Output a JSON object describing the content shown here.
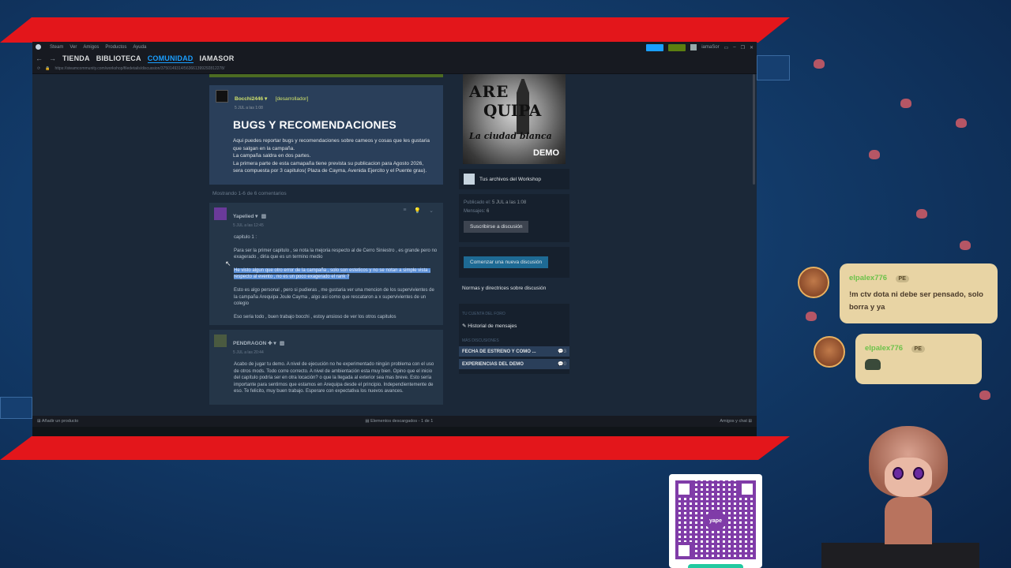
{
  "titlebar": {
    "menu": [
      "Steam",
      "Ver",
      "Amigos",
      "Productos",
      "Ayuda"
    ],
    "user": "iamaSor"
  },
  "nav": {
    "items": [
      "TIENDA",
      "BIBLIOTECA",
      "COMUNIDAD",
      "IAMASOR"
    ],
    "active": "COMUNIDAD",
    "url": "https://steamcommunity.com/workshop/filedetails/discussion/3750149314/563661399292812278/"
  },
  "op": {
    "author": "Bocchi2446",
    "role": "[desarrollador]",
    "date": "5 JUL a las 1:08",
    "title": "BUGS Y RECOMENDACIONES",
    "body": [
      "Aqui puedes reportar bugs y recomendaciones sobre cameos y cosas que les gustaria que salgan en la campaña.",
      "La campaña saldra en dos partes.",
      "La primera parte de esta camapaña tiene prevista su publicacion para Agosto 2026, sera compuesta por 3 capitulos( Plaza de Cayma, Avenida Ejercito y el Puente grau)."
    ]
  },
  "showing": "Mostrando 1-6 de 6 comentarios",
  "comments": [
    {
      "author": "Yapelied",
      "date": "5 JUL a las 12:45",
      "paragraphs": [
        "capitulo 1 :",
        "Para ser la primer capitulo , se nota la mejoria respecto al de Cerro Siniestro , es grande pero no exagerado , diria que es un termino medio",
        "He visto algun que otro error de la campaña , solo son esteticos y no se notan a simple vista , respecto al evento , no es un poco exagerado el rank ?",
        "Esto es algo personal , pero si pudieras , me gustaria ver una mencion de los supervivientes de la campaña Arequipa Joule Cayma , algo asi como que rescataron a x supervivientes de un colegio",
        "Eso seria todo , buen trabajo bocchi , estoy ansioso de ver los otros capitulos"
      ]
    },
    {
      "author": "PENDRAGON",
      "date": "5 JUL a las 20:44",
      "paragraphs": [
        "Acabo de jugar tu demo. A nivel de ejecución no he experimentado ningún problema con el uso de otros mods. Todo corre correcto. A nivel de ambientación esta muy bien. Opino que el inicio del capítulo podría ser en otra locación? o que la llegada al exterior sea mas breve. Esto sería importante para sentirnos que estamos en Arequipa desde el principio. Independientemente de eso. Te felicito, muy buen trabajo. Esperare con expectativa los nuevos avances."
      ]
    }
  ],
  "sidebar": {
    "image": {
      "line1": "ARE",
      "line2": "QUIPA",
      "line3": "La ciudad blanca",
      "tag": "DEMO"
    },
    "workshop_files": "Tus archivos del Workshop",
    "published_label": "Publicado el:",
    "published_value": "5 JUL a las 1:08",
    "messages_label": "Mensajes:",
    "messages_value": "6",
    "subscribe_btn": "Suscribirse a discusión",
    "new_discussion_btn": "Comenzar una nueva discusión",
    "rules": "Normas y directrices sobre discusión",
    "forum_account_label": "TU CUENTA DEL FORO",
    "history": "Historial de mensajes",
    "more_discussions_label": "MÁS DISCUSIONES",
    "discussions": [
      {
        "title": "FECHA DE ESTRENO Y COMO ...",
        "count": "3"
      },
      {
        "title": "EXPERIENCIAS DEL DEMO",
        "count": "0"
      }
    ]
  },
  "statusbar": {
    "add_product": "Añadir un producto",
    "downloads": "Elementos descargados - 1 de 1",
    "friends": "Amigos y chat"
  },
  "chat": [
    {
      "user": "elpalex776",
      "badge": "PE",
      "message": "!m ctv dota ni debe ser pensado, solo borra y ya"
    },
    {
      "user": "elpalex776",
      "badge": "PE",
      "message": ""
    }
  ],
  "qr": {
    "brand": "yape"
  },
  "colors": {
    "red_band": "#e3161b",
    "steam_bg": "#1b2838",
    "accent": "#1a9fff",
    "dev_yellow": "#d1e36b",
    "chat_bubble": "#e8d4a4",
    "chat_user": "#6cc24a"
  }
}
